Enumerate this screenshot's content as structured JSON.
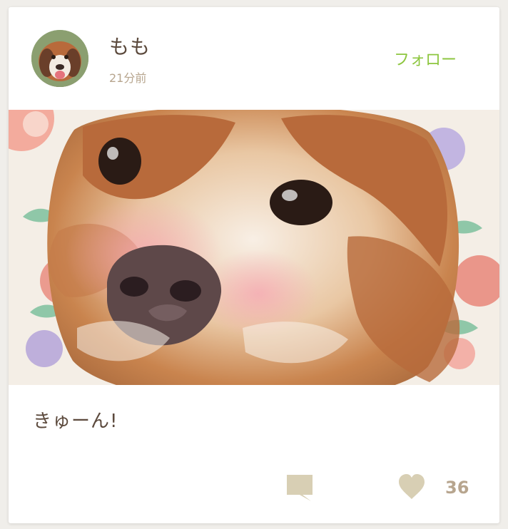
{
  "post": {
    "user": {
      "name": "もも",
      "time": "21分前",
      "avatar_icon": "dog-avatar"
    },
    "follow_label": "フォロー",
    "photo_subject": "cavalier-king-charles-spaniel-photo",
    "caption": "きゅーん!",
    "actions": {
      "comment_icon": "speech-bubble-icon",
      "like_icon": "heart-icon",
      "like_count": "36"
    }
  },
  "colors": {
    "accent": "#8dc63f",
    "text": "#5c4a3d",
    "muted": "#b7a58e",
    "icon": "#d8cfb4"
  }
}
